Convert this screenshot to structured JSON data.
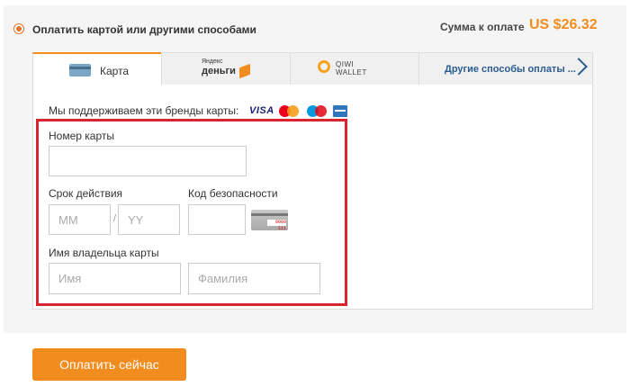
{
  "header": {
    "pay_option_label": "Оплатить картой или другими способами",
    "total_label": "Сумма к оплате",
    "total_value": "US $26.32"
  },
  "tabs": [
    {
      "label": "Карта",
      "icon": "credit-card-icon",
      "active": true
    },
    {
      "label": "Яндекс деньги",
      "brand_top": "Яндекс",
      "brand_bottom": "деньги",
      "icon": "yandex-money-icon",
      "active": false
    },
    {
      "label": "QIWI WALLET",
      "brand_top": "QIWI",
      "brand_bottom": "WALLET",
      "icon": "qiwi-icon",
      "active": false
    },
    {
      "label": "Другие способы оплаты ...",
      "icon": "chevron-right-icon",
      "active": false
    }
  ],
  "brands": {
    "label": "Мы поддерживаем эти бренды карты:",
    "items": [
      "visa",
      "mastercard",
      "maestro",
      "amex"
    ],
    "visa_text": "VISA"
  },
  "form": {
    "card_number_label": "Номер карты",
    "card_number_value": "",
    "expiry_label": "Срок действия",
    "month_placeholder": "MM",
    "year_placeholder": "YY",
    "separator": "/",
    "cvv_label": "Код безопасности",
    "cvv_value": "",
    "cvv_hint_code": "0000 111",
    "holder_label": "Имя владельца карты",
    "first_name_placeholder": "Имя",
    "last_name_placeholder": "Фамилия"
  },
  "actions": {
    "pay_now_label": "Оплатить сейчас"
  },
  "colors": {
    "accent": "#f28c1e",
    "highlight_frame": "#d9232f",
    "link": "#2a5c8f"
  }
}
